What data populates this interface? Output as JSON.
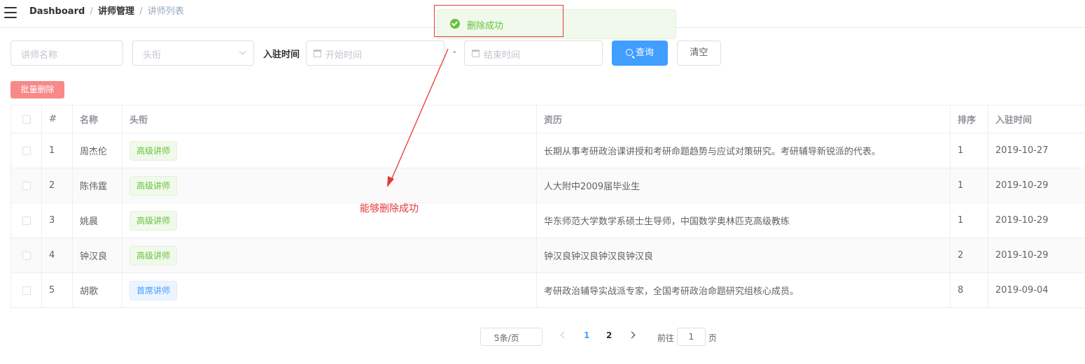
{
  "header": {
    "breadcrumb": [
      "Dashboard",
      "讲师管理",
      "讲师列表"
    ],
    "separator": "/"
  },
  "toast": {
    "message": "删除成功",
    "status_color": "#67c23a"
  },
  "filters": {
    "name_placeholder": "讲师名称",
    "level_placeholder": "头衔",
    "date_label": "入驻时间",
    "start_placeholder": "开始时间",
    "date_separator": "-",
    "end_placeholder": "结束时间",
    "search_label": "查询",
    "clear_label": "清空"
  },
  "batch_delete_label": "批量删除",
  "table": {
    "headers": [
      "#",
      "名称",
      "头衔",
      "资历",
      "排序",
      "入驻时间"
    ],
    "rows": [
      {
        "index": "1",
        "name": "周杰伦",
        "level": "高级讲师",
        "level_type": "success",
        "intro": "长期从事考研政治课讲授和考研命题趋势与应试对策研究。考研辅导新锐派的代表。",
        "sort": "1",
        "date": "2019-10-27"
      },
      {
        "index": "2",
        "name": "陈伟霆",
        "level": "高级讲师",
        "level_type": "success",
        "intro": "人大附中2009届毕业生",
        "sort": "1",
        "date": "2019-10-29"
      },
      {
        "index": "3",
        "name": "姚晨",
        "level": "高级讲师",
        "level_type": "success",
        "intro": "华东师范大学数学系硕士生导师，中国数学奥林匹克高级教练",
        "sort": "1",
        "date": "2019-10-29"
      },
      {
        "index": "4",
        "name": "钟汉良",
        "level": "高级讲师",
        "level_type": "success",
        "intro": "钟汉良钟汉良钟汉良钟汉良",
        "sort": "2",
        "date": "2019-10-29"
      },
      {
        "index": "5",
        "name": "胡歌",
        "level": "首席讲师",
        "level_type": "info",
        "intro": "考研政治辅导实战派专家，全国考研政治命题研究组核心成员。",
        "sort": "8",
        "date": "2019-09-04"
      }
    ]
  },
  "annotation": "能够删除成功",
  "pagination": {
    "page_size": "5条/页",
    "pages": [
      "1",
      "2"
    ],
    "current_page": "1",
    "goto_prefix": "前往",
    "goto_value": "1",
    "goto_suffix": "页"
  },
  "colors": {
    "primary": "#409eff",
    "danger": "#f78989",
    "success": "#67c23a",
    "annotation": "#e53935"
  }
}
